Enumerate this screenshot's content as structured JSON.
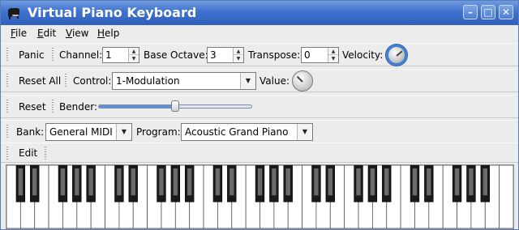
{
  "window": {
    "title": "Virtual Piano Keyboard",
    "icons": {
      "app": "piano-app-icon",
      "minimize": "minimize-icon",
      "maximize": "maximize-icon",
      "close": "close-icon"
    },
    "minimize_glyph": "–",
    "maximize_glyph": "□",
    "close_glyph": "✕"
  },
  "menu": {
    "items": [
      {
        "label": "File",
        "mnemonic": "F",
        "rest": "ile"
      },
      {
        "label": "Edit",
        "mnemonic": "E",
        "rest": "dit"
      },
      {
        "label": "View",
        "mnemonic": "V",
        "rest": "iew"
      },
      {
        "label": "Help",
        "mnemonic": "H",
        "rest": "elp"
      }
    ]
  },
  "toolbar1": {
    "panic": "Panic",
    "channel_label": "Channel:",
    "channel_value": "1",
    "octave_label": "Base Octave:",
    "octave_value": "3",
    "transpose_label": "Transpose:",
    "transpose_value": "0",
    "velocity_label": "Velocity:"
  },
  "toolbar2": {
    "reset_all": "Reset All",
    "control_label": "Control:",
    "control_value": "1-Modulation",
    "value_label": "Value:"
  },
  "toolbar3": {
    "reset": "Reset",
    "bender_label": "Bender:",
    "bender_position": 0.5
  },
  "toolbar4": {
    "bank_label": "Bank:",
    "bank_value": "General MIDI",
    "program_label": "Program:",
    "program_value": "Acoustic Grand Piano"
  },
  "toolbar5": {
    "edit": "Edit"
  },
  "keyboard": {
    "white_keys": 36,
    "octaves": 5
  },
  "colors": {
    "title_bar": "#3f72cf",
    "accent": "#3f80d2",
    "window_bg": "#ececec"
  }
}
